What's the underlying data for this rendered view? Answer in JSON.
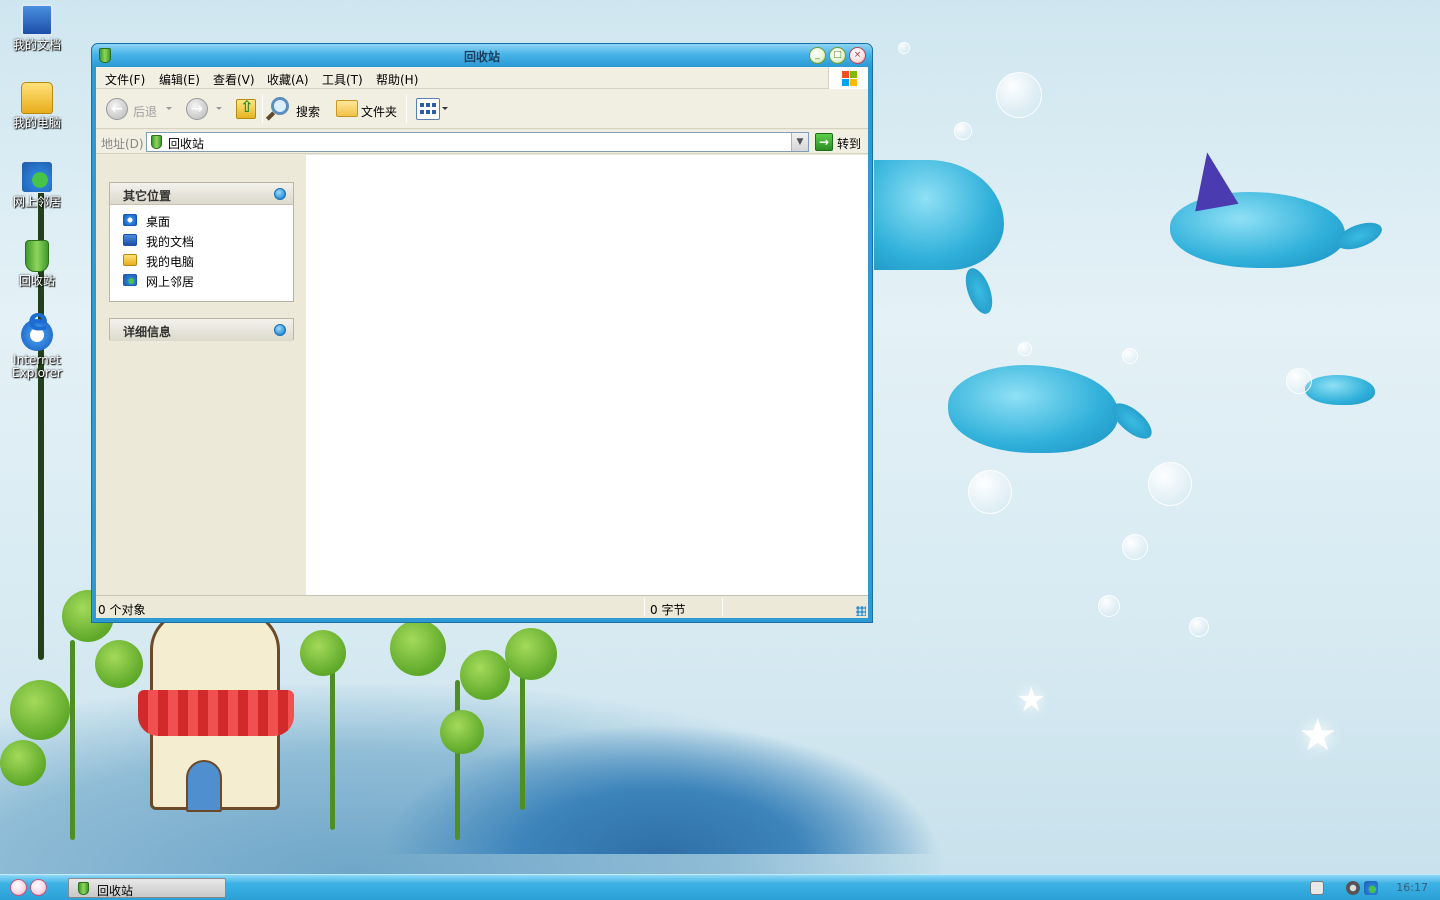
{
  "desktop": {
    "icons": [
      {
        "label": "我的文档",
        "icon": "documents-icon"
      },
      {
        "label": "我的电脑",
        "icon": "computer-icon"
      },
      {
        "label": "网上邻居",
        "icon": "network-icon"
      },
      {
        "label": "回收站",
        "icon": "recycle-bin-icon"
      },
      {
        "label_line1": "Internet",
        "label_line2": "Explorer",
        "icon": "internet-explorer-icon"
      }
    ]
  },
  "window": {
    "title": "回收站",
    "menu": [
      "文件(F)",
      "编辑(E)",
      "查看(V)",
      "收藏(A)",
      "工具(T)",
      "帮助(H)"
    ],
    "toolbar": {
      "back_label": "后退",
      "search_label": "搜索",
      "folders_label": "文件夹"
    },
    "address": {
      "label": "地址(D)",
      "value": "回收站",
      "go_label": "转到"
    },
    "sidebar": {
      "other_places": {
        "title": "其它位置",
        "items": [
          "桌面",
          "我的文档",
          "我的电脑",
          "网上邻居"
        ]
      },
      "details": {
        "title": "详细信息"
      }
    },
    "status": {
      "objects": "0 个对象",
      "size": "0 字节"
    }
  },
  "taskbar": {
    "task_label": "回收站",
    "clock": "16:17"
  },
  "colors": {
    "titlebar": "#47b4e8",
    "window_frame": "#2d9ad4",
    "taskbar": "#2aa0d6",
    "panel_bg": "#ece9d8"
  }
}
